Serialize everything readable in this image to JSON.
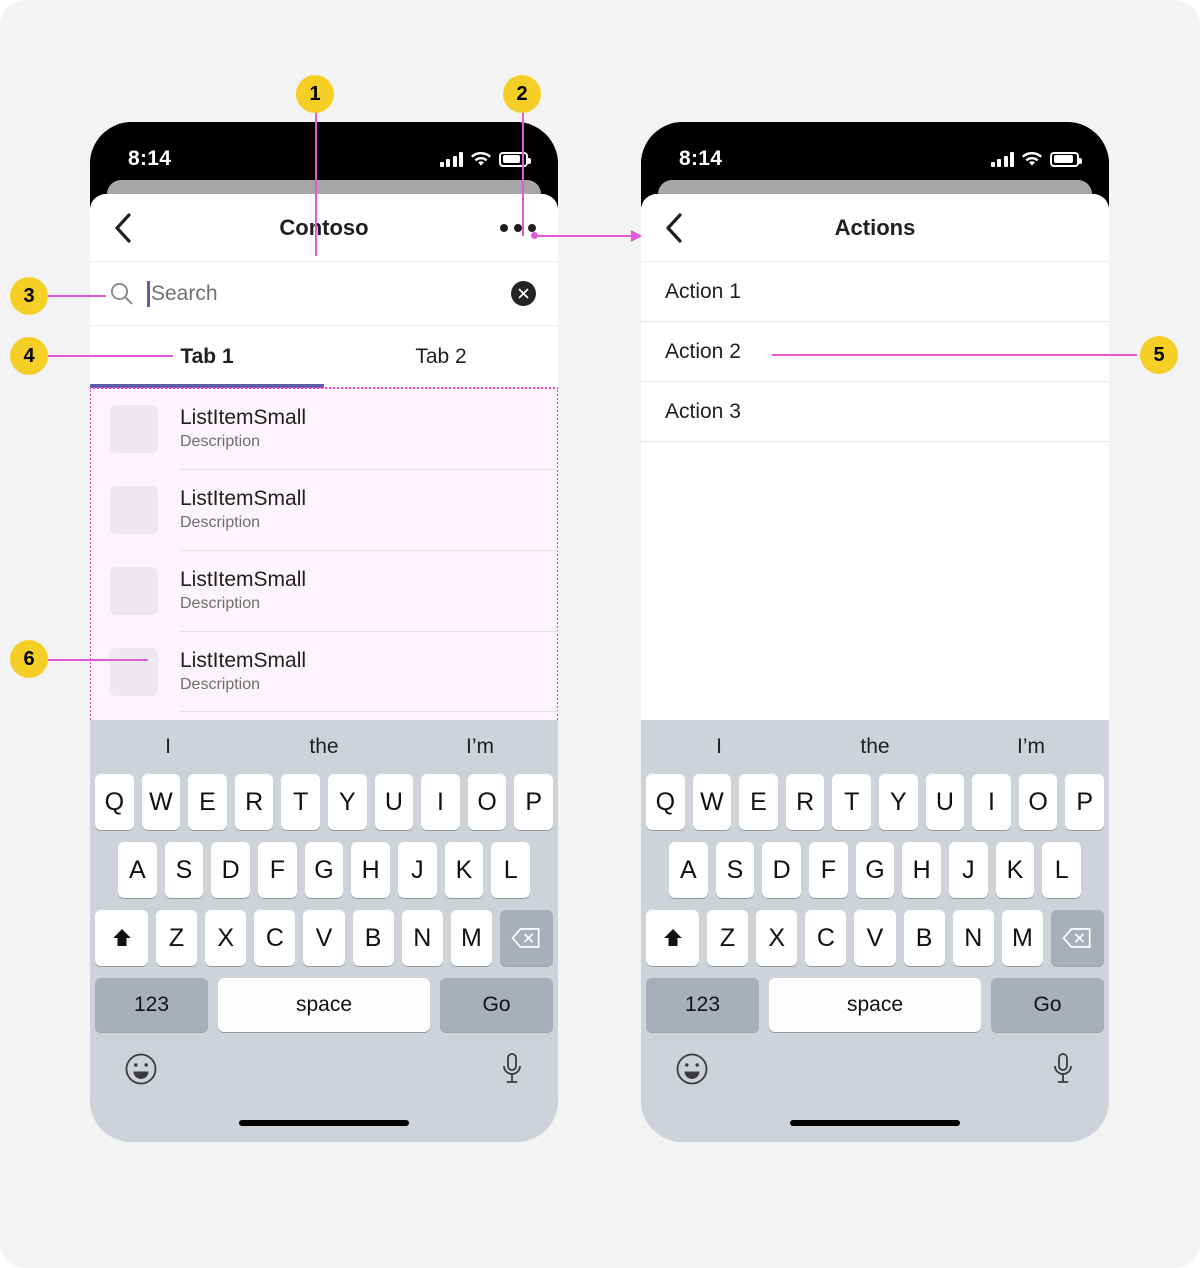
{
  "page": {
    "background": "#f3f3f3",
    "accent_callout": "#f5cf26",
    "accent_leader": "#e459d6",
    "accent_tab": "#5b5fa8",
    "highlight_fill": "#fdf4fb"
  },
  "callouts": [
    {
      "number": "1",
      "target": "nav-title"
    },
    {
      "number": "2",
      "target": "overflow-more-button"
    },
    {
      "number": "3",
      "target": "search-bar"
    },
    {
      "number": "4",
      "target": "tab-list"
    },
    {
      "number": "5",
      "target": "action-2-row"
    },
    {
      "number": "6",
      "target": "list-region"
    }
  ],
  "phone_left": {
    "status_bar": {
      "time": "8:14",
      "icons": [
        "signal-icon",
        "wifi-icon",
        "battery-icon"
      ]
    },
    "nav": {
      "back_icon": "chevron-left-icon",
      "title": "Contoso",
      "more_icon": "more-horizontal-icon"
    },
    "search": {
      "icon": "search-icon",
      "placeholder": "Search",
      "value": "",
      "clear_icon": "dismiss-circle-icon"
    },
    "tabs": [
      {
        "label": "Tab 1",
        "selected": true
      },
      {
        "label": "Tab 2",
        "selected": false
      }
    ],
    "list_items": [
      {
        "title": "ListItemSmall",
        "description": "Description"
      },
      {
        "title": "ListItemSmall",
        "description": "Description"
      },
      {
        "title": "ListItemSmall",
        "description": "Description"
      },
      {
        "title": "ListItemSmall",
        "description": "Description"
      }
    ]
  },
  "phone_right": {
    "status_bar": {
      "time": "8:14",
      "icons": [
        "signal-icon",
        "wifi-icon",
        "battery-icon"
      ]
    },
    "nav": {
      "back_icon": "chevron-left-icon",
      "title": "Actions"
    },
    "actions": [
      {
        "label": "Action 1"
      },
      {
        "label": "Action 2"
      },
      {
        "label": "Action 3"
      }
    ]
  },
  "keyboard": {
    "suggestions": [
      "I",
      "the",
      "I’m"
    ],
    "row1": [
      "Q",
      "W",
      "E",
      "R",
      "T",
      "Y",
      "U",
      "I",
      "O",
      "P"
    ],
    "row2": [
      "A",
      "S",
      "D",
      "F",
      "G",
      "H",
      "J",
      "K",
      "L"
    ],
    "row3": [
      "Z",
      "X",
      "C",
      "V",
      "B",
      "N",
      "M"
    ],
    "shift_icon": "shift-up-icon",
    "backspace_icon": "backspace-icon",
    "numbers_label": "123",
    "space_label": "space",
    "return_label": "Go",
    "emoji_icon": "emoji-smile-icon",
    "mic_icon": "microphone-icon"
  }
}
